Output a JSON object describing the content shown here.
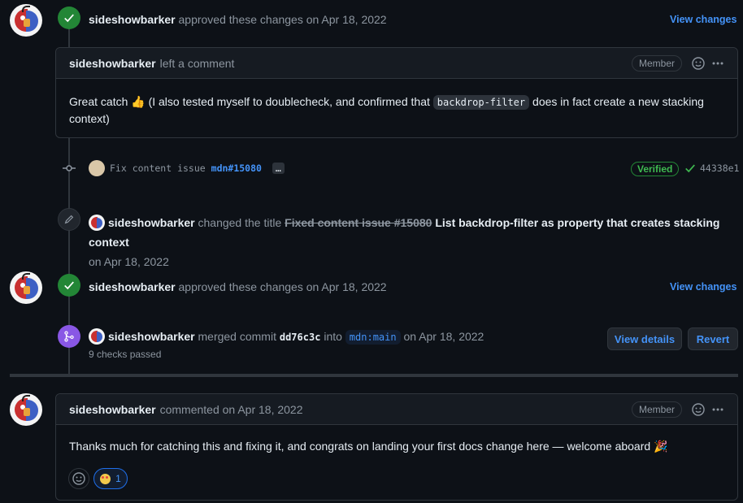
{
  "user": "sideshowbarker",
  "review1": {
    "action": "approved these changes on Apr 18, 2022",
    "view_link": "View changes"
  },
  "comment1": {
    "author": "sideshowbarker",
    "action": "left a comment",
    "role": "Member",
    "body_pre": "Great catch 👍 (I also tested myself to doublecheck, and confirmed that ",
    "body_code": "backdrop-filter",
    "body_post": " does in fact create a new stacking",
    "body_line2": "context)"
  },
  "commit": {
    "message": "Fix content issue",
    "ref": "mdn#15080",
    "ellipsis": "…",
    "verified": "Verified",
    "sha": "44338e1"
  },
  "rename": {
    "author": "sideshowbarker",
    "action": "changed the title",
    "old_title": "Fixed content issue #15080",
    "new_title": "List backdrop-filter as property that creates stacking context",
    "date": "on Apr 18, 2022"
  },
  "review2": {
    "action": "approved these changes on Apr 18, 2022",
    "view_link": "View changes"
  },
  "merge": {
    "author": "sideshowbarker",
    "action": "merged commit",
    "sha": "dd76c3c",
    "into": "into",
    "branch": "mdn:main",
    "date": "on Apr 18, 2022",
    "checks": "9 checks passed",
    "view_details": "View details",
    "revert": "Revert"
  },
  "comment2": {
    "author": "sideshowbarker",
    "action": "commented on Apr 18, 2022",
    "role": "Member",
    "body": "Thanks much for catching this and fixing it, and congrats on landing your first docs change here — welcome aboard 🎉",
    "reaction_count": "1"
  },
  "colors": {
    "background": "#0d1117",
    "accent_link": "#4493f8",
    "approved_green": "#238636",
    "merged_purple": "#8957e5"
  }
}
